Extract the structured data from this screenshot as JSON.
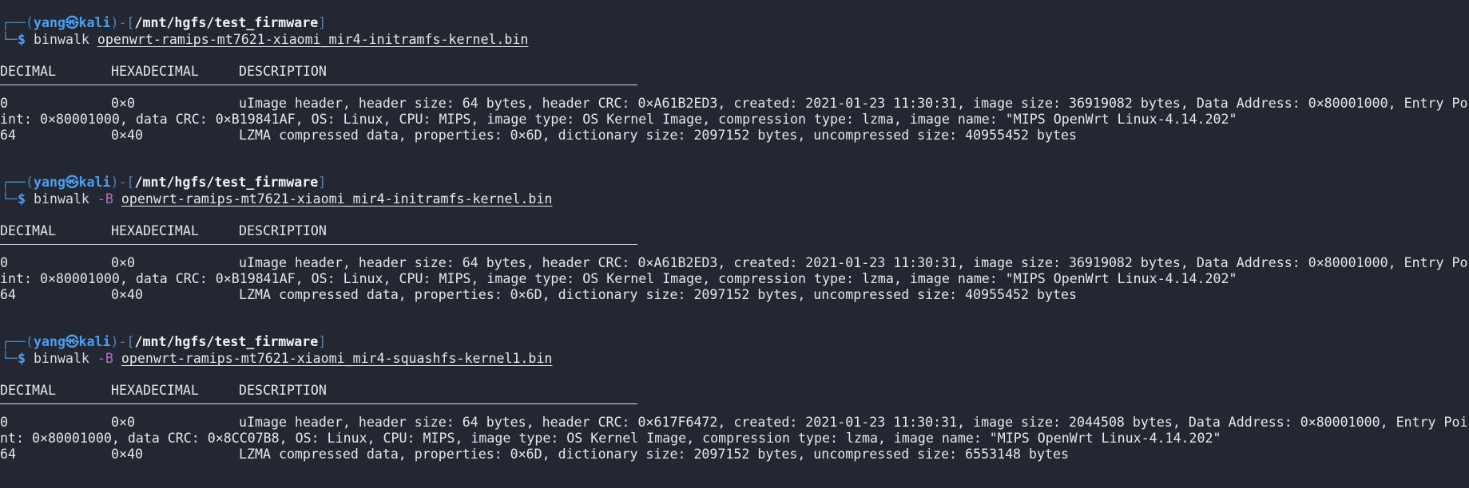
{
  "blocks": [
    {
      "prompt": {
        "frame_open": "┌──(",
        "user": "yang",
        "at": "㉿",
        "host": "kali",
        "frame_mid": ")-[",
        "path": "/mnt/hgfs/test_firmware",
        "frame_close": "]",
        "frame_bottom": "└─",
        "dollar": "$"
      },
      "command": "binwalk",
      "flag": "",
      "argument": "openwrt-ramips-mt7621-xiaomi_mir4-initramfs-kernel.bin",
      "headers": [
        "DECIMAL",
        "HEXADECIMAL",
        "DESCRIPTION"
      ],
      "rows": [
        {
          "decimal": "0",
          "hex": "0×0",
          "description": "uImage header, header size: 64 bytes, header CRC: 0×A61B2ED3, created: 2021-01-23 11:30:31, image size: 36919082 bytes, Data Address: 0×80001000, Entry Po",
          "continuation": "int: 0×80001000, data CRC: 0×B19841AF, OS: Linux, CPU: MIPS, image type: OS Kernel Image, compression type: lzma, image name: \"MIPS OpenWrt Linux-4.14.202\""
        },
        {
          "decimal": "64",
          "hex": "0×40",
          "description": "LZMA compressed data, properties: 0×6D, dictionary size: 2097152 bytes, uncompressed size: 40955452 bytes",
          "continuation": ""
        }
      ]
    },
    {
      "prompt": {
        "frame_open": "┌──(",
        "user": "yang",
        "at": "㉿",
        "host": "kali",
        "frame_mid": ")-[",
        "path": "/mnt/hgfs/test_firmware",
        "frame_close": "]",
        "frame_bottom": "└─",
        "dollar": "$"
      },
      "command": "binwalk",
      "flag": "-B",
      "argument": "openwrt-ramips-mt7621-xiaomi_mir4-initramfs-kernel.bin",
      "headers": [
        "DECIMAL",
        "HEXADECIMAL",
        "DESCRIPTION"
      ],
      "rows": [
        {
          "decimal": "0",
          "hex": "0×0",
          "description": "uImage header, header size: 64 bytes, header CRC: 0×A61B2ED3, created: 2021-01-23 11:30:31, image size: 36919082 bytes, Data Address: 0×80001000, Entry Po",
          "continuation": "int: 0×80001000, data CRC: 0×B19841AF, OS: Linux, CPU: MIPS, image type: OS Kernel Image, compression type: lzma, image name: \"MIPS OpenWrt Linux-4.14.202\""
        },
        {
          "decimal": "64",
          "hex": "0×40",
          "description": "LZMA compressed data, properties: 0×6D, dictionary size: 2097152 bytes, uncompressed size: 40955452 bytes",
          "continuation": ""
        }
      ]
    },
    {
      "prompt": {
        "frame_open": "┌──(",
        "user": "yang",
        "at": "㉿",
        "host": "kali",
        "frame_mid": ")-[",
        "path": "/mnt/hgfs/test_firmware",
        "frame_close": "]",
        "frame_bottom": "└─",
        "dollar": "$"
      },
      "command": "binwalk",
      "flag": "-B",
      "argument": "openwrt-ramips-mt7621-xiaomi_mir4-squashfs-kernel1.bin",
      "headers": [
        "DECIMAL",
        "HEXADECIMAL",
        "DESCRIPTION"
      ],
      "rows": [
        {
          "decimal": "0",
          "hex": "0×0",
          "description": "uImage header, header size: 64 bytes, header CRC: 0×617F6472, created: 2021-01-23 11:30:31, image size: 2044508 bytes, Data Address: 0×80001000, Entry Poi",
          "continuation": "nt: 0×80001000, data CRC: 0×8CC07B8, OS: Linux, CPU: MIPS, image type: OS Kernel Image, compression type: lzma, image name: \"MIPS OpenWrt Linux-4.14.202\""
        },
        {
          "decimal": "64",
          "hex": "0×40",
          "description": "LZMA compressed data, properties: 0×6D, dictionary size: 2097152 bytes, uncompressed size: 6553148 bytes",
          "continuation": ""
        }
      ]
    }
  ],
  "colors": {
    "background": "#222731",
    "frame": "#4d86b8",
    "user": "#4e9ff0",
    "flag": "#b66fc9",
    "text": "#e4e6ea"
  }
}
